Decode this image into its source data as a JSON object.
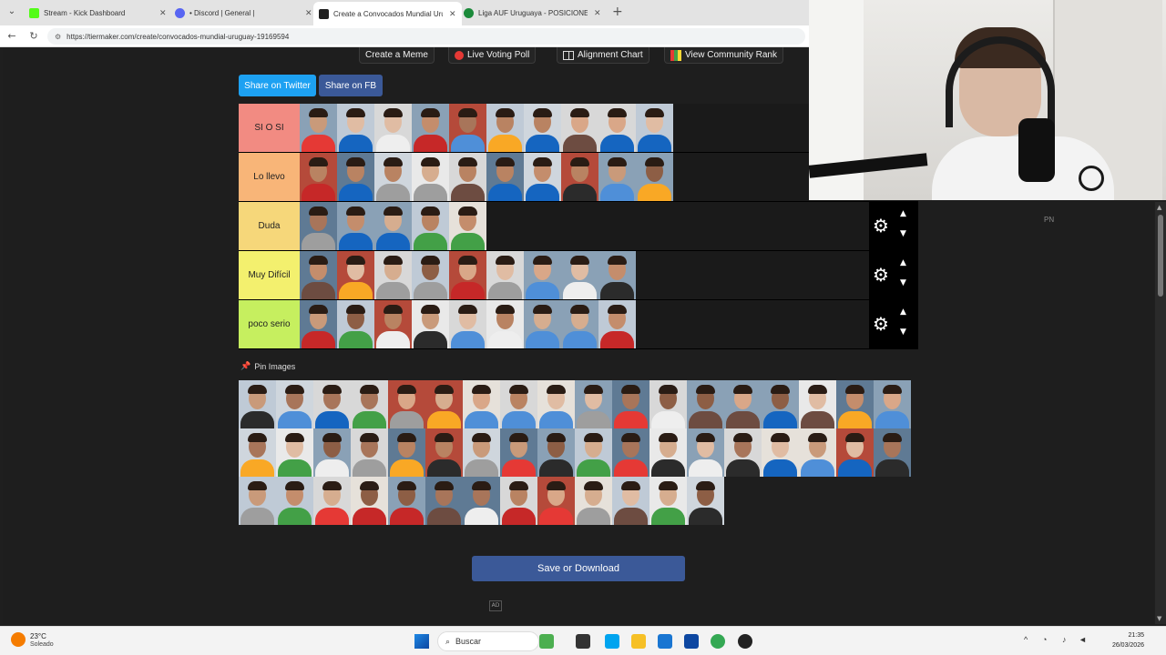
{
  "browser": {
    "tabs": [
      {
        "title": "Stream - Kick Dashboard",
        "favicon_color": "#53fc18",
        "active": false
      },
      {
        "title": "• Discord | General |  ",
        "favicon_color": "#5865f2",
        "active": false
      },
      {
        "title": "Create a Convocados Mundial Uru",
        "favicon_color": "#1f1f1f",
        "active": true
      },
      {
        "title": "Liga AUF Uruguaya - POSICIONES",
        "favicon_color": "#1b8a3a",
        "active": false
      }
    ],
    "new_tab": "+",
    "url": "https://tiermaker.com/create/convocados-mundial-uruguay-19169594"
  },
  "top_buttons": {
    "create_meme": "Create a Meme",
    "live_voting": "Live Voting Poll",
    "alignment": "Alignment Chart",
    "community_rank": "View Community Rank"
  },
  "share": {
    "twitter": "Share on Twitter",
    "fb": "Share on FB"
  },
  "tiers": [
    {
      "label": "SI O SI",
      "color": "#f28b82",
      "count": 10
    },
    {
      "label": "Lo llevo",
      "color": "#f8b578",
      "count": 10
    },
    {
      "label": "Duda",
      "color": "#f6d77a",
      "count": 5
    },
    {
      "label": "Muy Difícil",
      "color": "#f3f06e",
      "count": 9
    },
    {
      "label": "poco serio",
      "color": "#c6ef5f",
      "count": 9
    }
  ],
  "pin_label": "Pin Images",
  "pool_counts": [
    18,
    18,
    13
  ],
  "save_button": "Save or Download",
  "ad_label": "AD",
  "side_label": "PN",
  "taskbar": {
    "weather_temp": "23°C",
    "weather_desc": "Soleado",
    "search": "Buscar",
    "time": "21:35",
    "date": "26/03/2026"
  }
}
